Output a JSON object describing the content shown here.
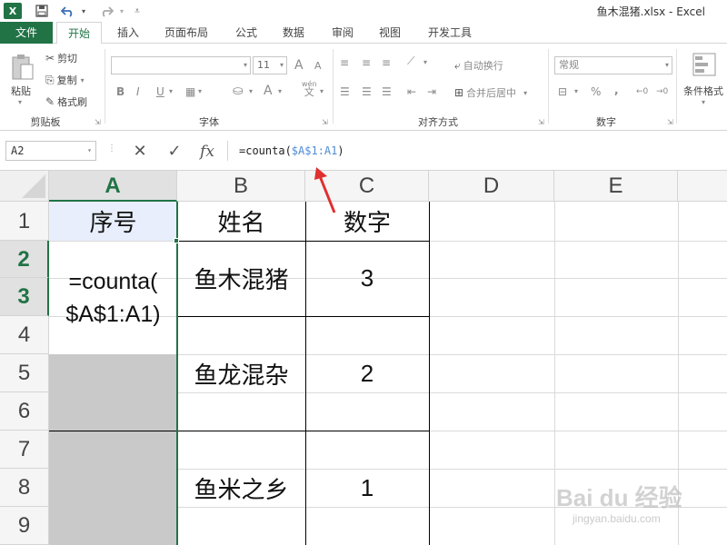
{
  "title": "鱼木混猪.xlsx - Excel",
  "quick_access": {
    "logo": "X",
    "save": "save-icon",
    "undo": "undo-icon",
    "redo": "redo-icon",
    "customize": "customize-icon"
  },
  "tabs": [
    "文件",
    "开始",
    "插入",
    "页面布局",
    "公式",
    "数据",
    "审阅",
    "视图",
    "开发工具"
  ],
  "ribbon": {
    "clipboard": {
      "paste": "粘贴",
      "cut": "剪切",
      "copy": "复制",
      "format_painter": "格式刷",
      "label": "剪贴板"
    },
    "font": {
      "size": "11",
      "bold": "B",
      "italic": "I",
      "underline": "U",
      "grow": "A",
      "shrink": "A",
      "font_color": "A",
      "phonetic_top": "wén",
      "phonetic_bottom": "文",
      "label": "字体"
    },
    "alignment": {
      "wrap_text": "自动换行",
      "merge_center": "合并后居中",
      "label": "对齐方式"
    },
    "number": {
      "format": "常规",
      "percent": "%",
      "comma": ",",
      "label": "数字"
    },
    "styles": {
      "conditional": "条件格式"
    }
  },
  "name_box": "A2",
  "formula_bar": {
    "prefix": "=counta(",
    "ref": "$A$1:A1",
    "suffix": ")"
  },
  "columns": [
    "A",
    "B",
    "C",
    "D",
    "E"
  ],
  "rows": [
    "1",
    "2",
    "3",
    "4",
    "5",
    "6",
    "7",
    "8",
    "9"
  ],
  "cells": {
    "a1": "序号",
    "b1": "姓名",
    "c1": "数字",
    "a2_line1": "=counta(",
    "a2_line2": "$A$1:A1)",
    "b_group1": "鱼木混猪",
    "c_group1": "3",
    "b_group2": "鱼龙混杂",
    "c_group2": "2",
    "b_group3": "鱼米之乡",
    "c_group3": "1"
  },
  "watermark": {
    "top": "Bai du 经验",
    "bottom": "jingyan.baidu.com"
  },
  "colors": {
    "accent": "#217346",
    "annotation_arrow": "#e03030",
    "ref": "#4f8bd6"
  }
}
